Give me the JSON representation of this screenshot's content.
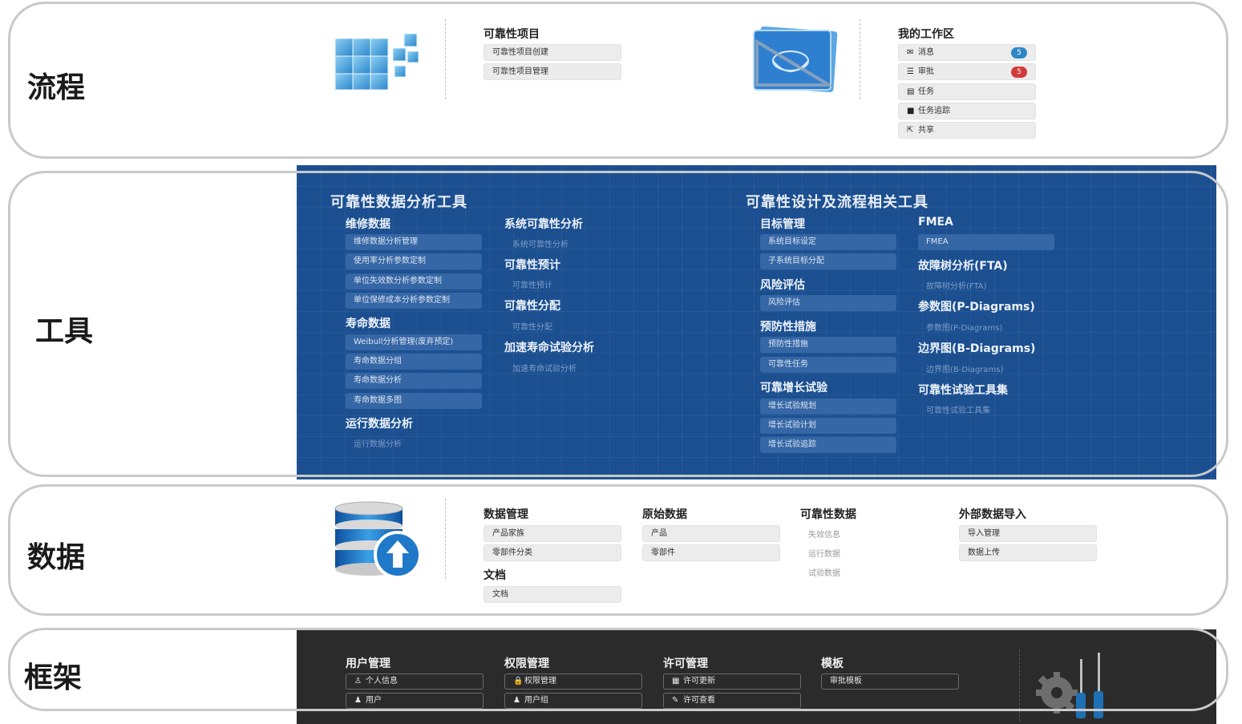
{
  "process": {
    "label": "流程",
    "reliability_project": {
      "title": "可靠性项目",
      "items": [
        "可靠性项目创建",
        "可靠性项目管理"
      ]
    },
    "workspace": {
      "title": "我的工作区",
      "items": [
        {
          "label": "消息",
          "icon": "envelope-icon",
          "glyph": "✉",
          "badge": "5",
          "badge_color": "#2f86c5"
        },
        {
          "label": "审批",
          "icon": "approval-icon",
          "glyph": "☰",
          "badge": "5",
          "badge_color": "#d23a3a"
        },
        {
          "label": "任务",
          "icon": "task-icon",
          "glyph": "▤"
        },
        {
          "label": "任务追踪",
          "icon": "task-tracking-icon",
          "glyph": "■"
        },
        {
          "label": "共享",
          "icon": "share-icon",
          "glyph": "⇱"
        }
      ]
    }
  },
  "tools": {
    "label": "工具",
    "analysis_title": "可靠性数据分析工具",
    "design_title": "可靠性设计及流程相关工具",
    "maintenance": {
      "title": "维修数据",
      "items": [
        "维修数据分析管理",
        "使用率分析参数定制",
        "单位失效数分析参数定制",
        "单位保修成本分析参数定制"
      ]
    },
    "life": {
      "title": "寿命数据",
      "items": [
        "Weibull分析管理(废弃预定)",
        "寿命数据分组",
        "寿命数据分析",
        "寿命数据多图"
      ]
    },
    "runtime": {
      "title": "运行数据分析",
      "link": "运行数据分析"
    },
    "system": {
      "title": "系统可靠性分析",
      "link": "系统可靠性分析"
    },
    "prediction": {
      "title": "可靠性预计",
      "link": "可靠性预计"
    },
    "allocation": {
      "title": "可靠性分配",
      "link": "可靠性分配"
    },
    "alt": {
      "title": "加速寿命试验分析",
      "link": "加速寿命试验分析"
    },
    "target": {
      "title": "目标管理",
      "items": [
        "系统目标设定",
        "子系统目标分配"
      ]
    },
    "risk": {
      "title": "风险评估",
      "items": [
        "风险评估"
      ]
    },
    "prevention": {
      "title": "预防性措施",
      "items": [
        "预防性措施",
        "可靠性任务"
      ]
    },
    "growth": {
      "title": "可靠增长试验",
      "items": [
        "增长试验规划",
        "增长试验计划",
        "增长试验追踪"
      ]
    },
    "fmea": {
      "title": "FMEA",
      "items": [
        "FMEA"
      ]
    },
    "fta": {
      "title": "故障树分析(FTA)",
      "link": "故障树分析(FTA)"
    },
    "pdiagram": {
      "title": "参数图(P-Diagrams)",
      "link": "参数图(P-Diagrams)"
    },
    "bdiagram": {
      "title": "边界图(B-Diagrams)",
      "link": "边界图(B-Diagrams)"
    },
    "testkit": {
      "title": "可靠性试验工具集",
      "link": "可靠性试验工具集"
    }
  },
  "data": {
    "label": "数据",
    "management": {
      "title": "数据管理",
      "items": [
        "产品家族",
        "零部件分类"
      ]
    },
    "documents": {
      "title": "文档",
      "items": [
        "文档"
      ]
    },
    "raw": {
      "title": "原始数据",
      "items": [
        "产品",
        "零部件"
      ]
    },
    "reliability": {
      "title": "可靠性数据",
      "links": [
        "失效信息",
        "运行数据",
        "试验数据"
      ]
    },
    "external": {
      "title": "外部数据导入",
      "items": [
        "导入管理",
        "数据上传"
      ]
    }
  },
  "framework": {
    "label": "框架",
    "users": {
      "title": "用户管理",
      "items": [
        {
          "label": "个人信息",
          "glyph": "♙"
        },
        {
          "label": "用户",
          "glyph": "♟"
        }
      ]
    },
    "permissions": {
      "title": "权限管理",
      "items": [
        {
          "label": "权限管理",
          "glyph": "🔒"
        },
        {
          "label": "用户组",
          "glyph": "♟"
        }
      ]
    },
    "license": {
      "title": "许可管理",
      "items": [
        {
          "label": "许可更新",
          "glyph": "▦"
        },
        {
          "label": "许可查看",
          "glyph": "✎"
        }
      ]
    },
    "templates": {
      "title": "模板",
      "items": [
        {
          "label": "审批模板",
          "glyph": ""
        }
      ]
    }
  },
  "colors": {
    "tools_panel": "#1b4f90",
    "framework_panel": "#2b2b2b",
    "badge_blue": "#2f86c5",
    "badge_red": "#d23a3a"
  }
}
